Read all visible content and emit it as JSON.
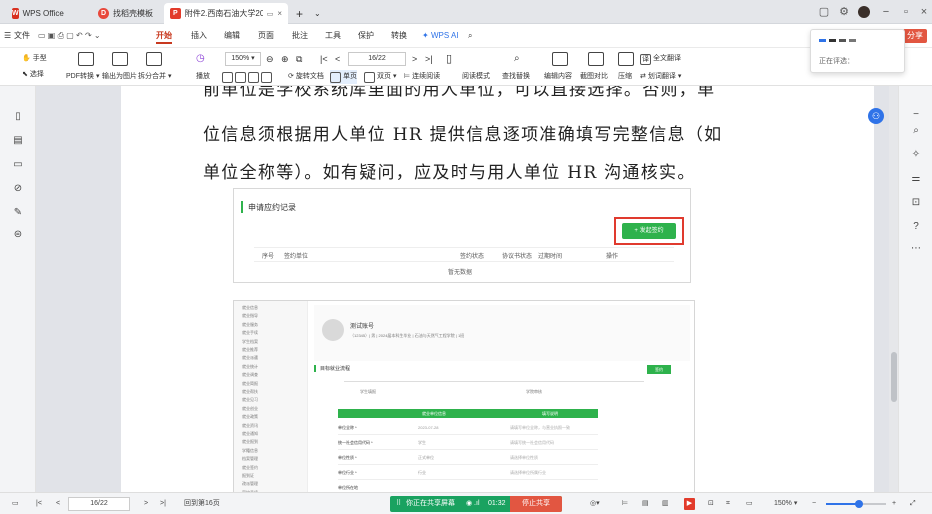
{
  "colors": {
    "accent": "#c8391f",
    "green": "#2eb24c",
    "share_orange": "#e25641",
    "teal": "#1aa260",
    "brand_blue": "#2f73e8"
  },
  "tabs": [
    {
      "label": "WPS Office",
      "icon": "wps-logo-icon"
    },
    {
      "label": "找稻壳模板",
      "icon": "docer-logo-icon"
    },
    {
      "label": "附件2.西南石油大学2024届毕",
      "icon": "pdf-file-icon"
    }
  ],
  "menu": [
    "文件",
    "开始",
    "插入",
    "编辑",
    "页面",
    "批注",
    "工具",
    "保护",
    "转换"
  ],
  "menu_active": "开始",
  "wps_ai": "WPS AI",
  "share_button": "分享",
  "toolbar": {
    "hand": "手型",
    "select": "选择",
    "pdf_convert": "PDF转换",
    "pdf_to_image": "输出为图片",
    "split_merge": "拆分合并",
    "play": "播放",
    "zoom": "150%",
    "rotate": "旋转文档",
    "page": "16/22",
    "single": "单页",
    "double": "双页",
    "continuous": "连续阅读",
    "read_mode": "阅读模式",
    "find_replace": "查找替换",
    "edit_content": "编辑内容",
    "screenshot_compare": "截图对比",
    "compress": "压缩",
    "full_translate": "全文翻译",
    "word_translate": "划词翻译"
  },
  "popup_status": "正在评选：",
  "document": {
    "lines": [
      "前单位是学校系统库里面的用人单位，可以直接选择。否则，单",
      "位信息须根据用人单位 HR 提供信息逐项准确填写完整信息（如",
      "单位全称等）。如有疑问，应及时与用人单位 HR 沟通核实。"
    ]
  },
  "shot1": {
    "title": "申请应约记录",
    "add_button": "+ 发起签约",
    "headers": [
      "序号",
      "签约单位",
      "签约状态",
      "协议书状态",
      "过期时间",
      "操作"
    ],
    "empty": "暂无数据"
  },
  "shot2": {
    "menu": [
      "就业信息",
      "就业指导",
      "就业服务",
      "就业手续",
      "学生档案",
      "就业推荐",
      "就业派遣",
      "就业统计",
      "就业调查",
      "就业简报",
      "就业帮扶",
      "就业见习",
      "就业创业",
      "就业政策",
      "就业资讯",
      "就业通知",
      "就业报到",
      "学籍信息",
      "档案管理",
      "就业签约",
      "报到证",
      "改派管理",
      "离校手续"
    ],
    "user": "测试账号",
    "user_info": "（12345）| 男 | 2024届本科生毕业 | 石油与天然气工程学院 | 1班",
    "section": "目标就业流程",
    "apply": "签约",
    "step1": "学生填报",
    "step2": "学院审核",
    "th1": "就业单位信息",
    "th2": "填写说明",
    "rows": [
      "单位全称 *",
      "统一社会信用代码 *",
      "单位性质 *",
      "单位行业 *",
      "单位所在地"
    ],
    "row_values": [
      "2023-07-28",
      "学生",
      "正式单位",
      "行业",
      ""
    ],
    "row_hints": [
      "请填写单位全称，与营业执照一致",
      "请填写统一社会信用代码",
      "请选择单位性质",
      "请选择单位所属行业",
      ""
    ]
  },
  "statusbar": {
    "page": "16/22",
    "goto": "回到第16页",
    "sharing": "你正在共享屏幕",
    "timer": "01:32",
    "stop": "停止共享",
    "zoom": "150%"
  }
}
